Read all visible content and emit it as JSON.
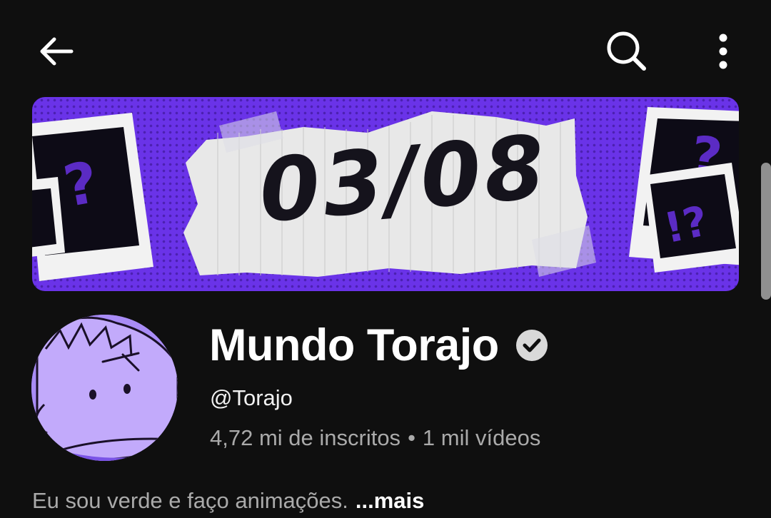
{
  "header": {
    "back_icon": "arrow-left-icon",
    "search_icon": "search-icon",
    "more_icon": "more-vertical-icon"
  },
  "banner": {
    "date_text": "03/08",
    "colors": {
      "background": "#6a33e8",
      "paper": "#e6e6e6"
    }
  },
  "channel": {
    "name": "Mundo Torajo",
    "verified_icon": "verified-check-icon",
    "handle": "@Torajo",
    "subscribers": "4,72 mi de inscritos",
    "separator": "•",
    "videos": "1 mil vídeos",
    "description": "Eu sou verde e faço animações.",
    "more_label": "...mais"
  }
}
